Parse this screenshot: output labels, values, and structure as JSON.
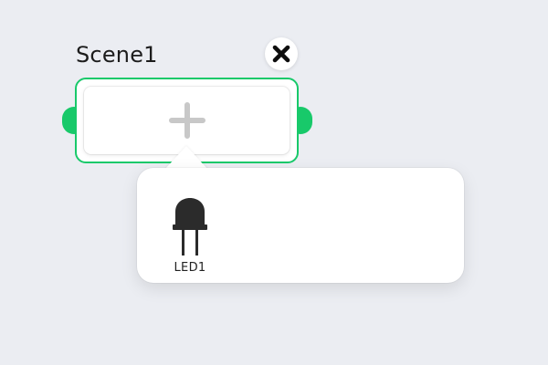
{
  "scene": {
    "title": "Scene1",
    "accent_color": "#18c96a"
  },
  "icons": {
    "close": "close-icon",
    "add": "plus-icon",
    "device": "led-icon"
  },
  "devices": [
    {
      "label": "LED1",
      "icon": "led-icon"
    }
  ]
}
